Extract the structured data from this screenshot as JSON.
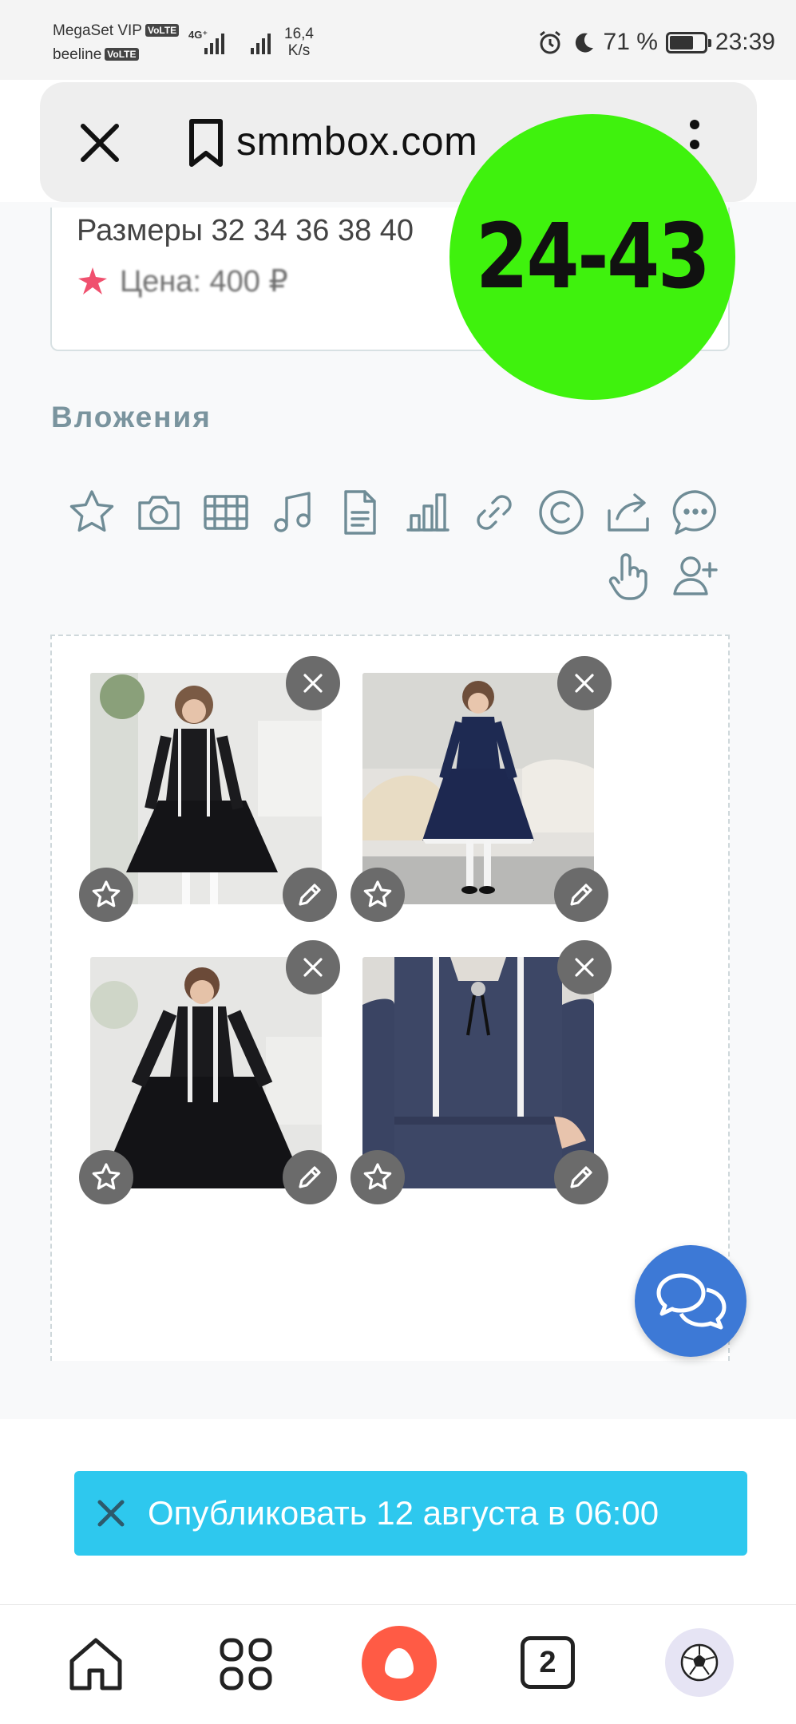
{
  "status_bar": {
    "carrier_1": "MegaSet VIP",
    "carrier_2": "beeline",
    "volte": "VoLTE",
    "network": "4G⁺",
    "speed_value": "16,4",
    "speed_unit": "K/s",
    "battery": "71 %",
    "time": "23:39"
  },
  "browser": {
    "url": "smmbox.com"
  },
  "post": {
    "sizes_line": "Размеры 32 34 36 38 40",
    "price_line": "Цена: 400 ₽",
    "sticker": "24-43"
  },
  "attachments": {
    "label": "Вложения",
    "tools": [
      "star-icon",
      "camera-icon",
      "film-icon",
      "music-icon",
      "document-icon",
      "chart-icon",
      "link-icon",
      "copyright-icon",
      "share-icon",
      "comment-icon",
      "hand-pointer-icon",
      "add-user-icon"
    ],
    "photos": [
      {
        "alt": "girl in black dress"
      },
      {
        "alt": "girl in navy dress"
      },
      {
        "alt": "girl in black dress with ruffles"
      },
      {
        "alt": "navy dress close-up with brooch"
      }
    ]
  },
  "publish": {
    "label": "Опубликовать 12 августа в 06:00"
  },
  "bottom_nav": {
    "tabs_count": "2"
  },
  "colors": {
    "sticker": "#3ff20d",
    "publish": "#2ec8ee",
    "chat_fab": "#3d79d6",
    "alice": "#ff5b45",
    "icon": "#6f8c96"
  }
}
